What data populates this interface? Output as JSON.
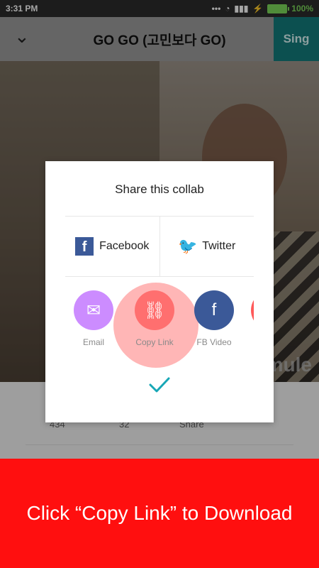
{
  "status_bar": {
    "time": "3:31 PM",
    "icons": [
      "dots-icon",
      "wifi-icon",
      "signal-icon",
      "charging-icon",
      "battery-icon"
    ],
    "battery": "100%"
  },
  "header": {
    "title": "GO GO (고민보다 GO)",
    "right_button": "Sing",
    "back_icon": "chevron-down-icon"
  },
  "video": {
    "watermark": "smule"
  },
  "stats": {
    "values": [
      "434",
      "32",
      "Share"
    ]
  },
  "dialog": {
    "title": "Share this collab",
    "platforms": [
      {
        "label": "Facebook",
        "icon": "facebook-icon"
      },
      {
        "label": "Twitter",
        "icon": "twitter-icon"
      }
    ],
    "share_items": [
      {
        "label": "Email",
        "icon": "mail-icon",
        "color": "#cc8cff"
      },
      {
        "label": "Copy Link",
        "icon": "link-icon",
        "color": "#ff6f6f"
      },
      {
        "label": "FB Video",
        "icon": "facebook-icon",
        "color": "#3b5998"
      }
    ],
    "confirm_icon": "check-icon"
  },
  "banner": {
    "text": "Click “Copy Link” to Download"
  },
  "colors": {
    "status_bar_bg": "#2b2b2b",
    "header_bg": "#9b9b9b",
    "sing_bg": "#137c7c",
    "banner_bg": "#ff0f0f",
    "check": "#18a7b6"
  }
}
